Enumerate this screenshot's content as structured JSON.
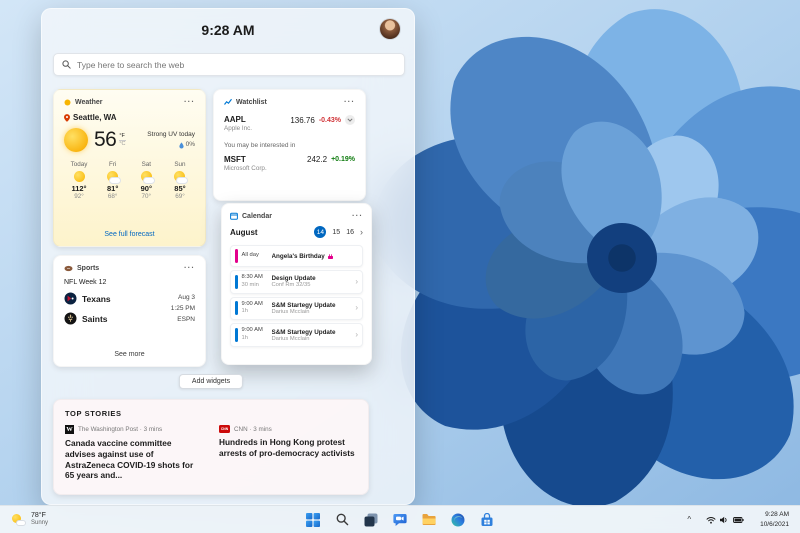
{
  "colors": {
    "accent": "#0067c0",
    "negative": "#d13438",
    "positive": "#107c10",
    "event_pink": "#e3008c",
    "event_blue": "#0078d4"
  },
  "icons": {
    "ellipsis": "···",
    "chevron_right": "›",
    "chevron_up": "^",
    "meta_sep": "·"
  },
  "panel": {
    "time": "9:28 AM",
    "search_placeholder": "Type here to search the web",
    "add_widgets_label": "Add widgets"
  },
  "weather": {
    "title": "Weather",
    "location": "Seattle, WA",
    "temp": "56",
    "unit_primary": "°F",
    "unit_secondary": "°C",
    "condition": "Strong UV today",
    "precipitation": "0%",
    "forecast": [
      {
        "day": "Today",
        "high": "112°",
        "low": "92°"
      },
      {
        "day": "Fri",
        "high": "81°",
        "low": "68°"
      },
      {
        "day": "Sat",
        "high": "90°",
        "low": "70°"
      },
      {
        "day": "Sun",
        "high": "85°",
        "low": "69°"
      }
    ],
    "footer": "See full forecast"
  },
  "watchlist": {
    "title": "Watchlist",
    "suggestion_label": "You may be interested in",
    "stocks": [
      {
        "symbol": "AAPL",
        "name": "Apple Inc.",
        "price": "136.76",
        "change": "-0.43%",
        "direction": "down"
      },
      {
        "symbol": "MSFT",
        "name": "Microsoft Corp.",
        "price": "242.2",
        "change": "+0.19%",
        "direction": "up"
      }
    ]
  },
  "calendar": {
    "title": "Calendar",
    "month": "August",
    "days": [
      "14",
      "15",
      "16"
    ],
    "selected_day": "14",
    "events": [
      {
        "time": "All day",
        "duration": "",
        "title": "Angela's Birthday",
        "subtitle": "",
        "color": "#e3008c"
      },
      {
        "time": "8:30 AM",
        "duration": "30 min",
        "title": "Design Update",
        "subtitle": "Conf Rm 32/35",
        "color": "#0078d4"
      },
      {
        "time": "9:00 AM",
        "duration": "1h",
        "title": "S&M Startegy Update",
        "subtitle": "Darius Mcclain",
        "color": "#0078d4"
      },
      {
        "time": "9:00 AM",
        "duration": "1h",
        "title": "S&M Startegy Update",
        "subtitle": "Darius Mcclain",
        "color": "#0078d4"
      }
    ]
  },
  "sports": {
    "title": "Sports",
    "league": "NFL Week 12",
    "teams": [
      "Texans",
      "Saints"
    ],
    "game_date": "Aug 3",
    "game_time": "1:25 PM",
    "network": "ESPN",
    "footer": "See more"
  },
  "top_stories": {
    "header": "TOP STORIES",
    "stories": [
      {
        "logo_text": "W",
        "meta": "The Washington Post · 3 mins",
        "headline": "Canada vaccine committee advises against use of AstraZeneca COVID-19 shots for 65 years and..."
      },
      {
        "logo_text": "CNN",
        "meta": "CNN · 3 mins",
        "headline": "Hundreds in Hong Kong protest arrests of pro-democracy activists"
      }
    ]
  },
  "taskbar": {
    "weather_temp": "78°F",
    "weather_condition": "Sunny",
    "apps": [
      "Start",
      "Search",
      "Task View",
      "Chat",
      "File Explorer",
      "Edge",
      "Store"
    ],
    "tray_time": "9:28 AM",
    "tray_date": "10/6/2021"
  }
}
